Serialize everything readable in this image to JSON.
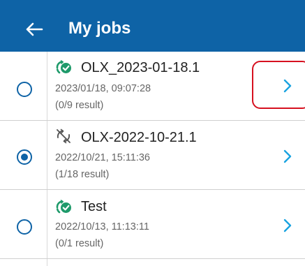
{
  "header": {
    "back_icon": "arrow-left-icon",
    "title": "My jobs",
    "background_color": "#0e63a6"
  },
  "jobs": [
    {
      "name": "OLX_2023-01-18.1",
      "date": "2023/01/18, 09:07:28",
      "result": "(0/9 result)",
      "status_icon": "sync-check-icon",
      "selected": false
    },
    {
      "name": "OLX-2022-10-21.1",
      "date": "2022/10/21, 15:11:36",
      "result": "(1/18 result)",
      "status_icon": "sync-disabled-icon",
      "selected": true
    },
    {
      "name": "Test",
      "date": "2022/10/13, 11:13:11",
      "result": "(0/1 result)",
      "status_icon": "sync-check-icon",
      "selected": false
    }
  ],
  "colors": {
    "accent": "#0e63a6",
    "status_ok": "#1e9a6a",
    "highlight": "#d6101f",
    "chevron": "#1aa3e0"
  }
}
